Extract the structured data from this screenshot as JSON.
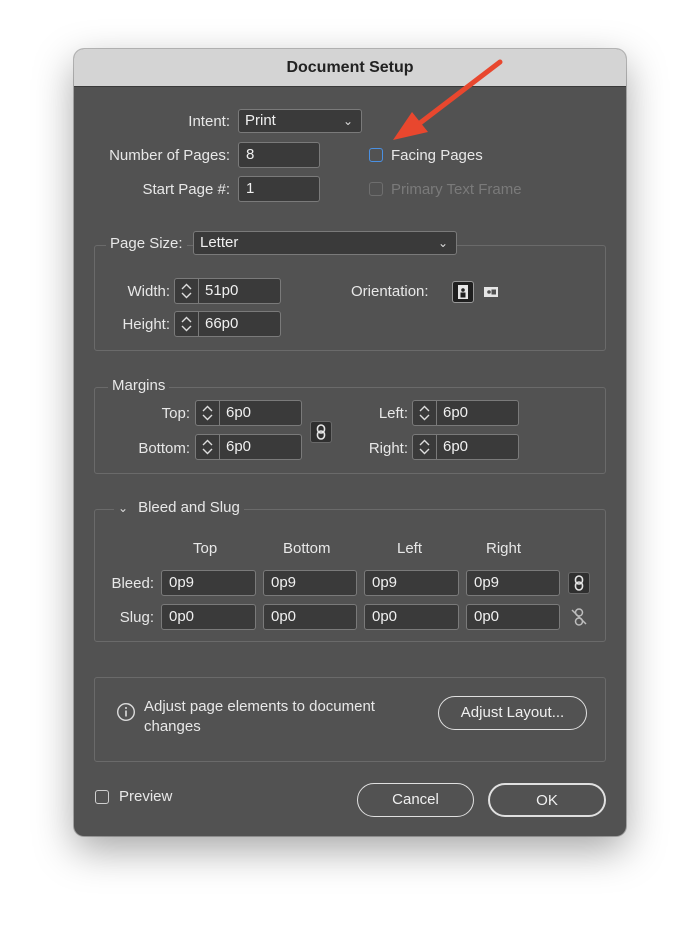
{
  "dialog": {
    "title": "Document Setup"
  },
  "general": {
    "intent_label": "Intent:",
    "intent_value": "Print",
    "num_pages_label": "Number of Pages:",
    "num_pages_value": "8",
    "start_page_label": "Start Page #:",
    "start_page_value": "1",
    "facing_pages_label": "Facing Pages",
    "facing_pages_checked": false,
    "primary_text_frame_label": "Primary Text Frame",
    "primary_text_frame_enabled": false
  },
  "page_size": {
    "label": "Page Size:",
    "value": "Letter",
    "width_label": "Width:",
    "width_value": "51p0",
    "height_label": "Height:",
    "height_value": "66p0",
    "orientation_label": "Orientation:",
    "orientation_selected": "portrait"
  },
  "margins": {
    "legend": "Margins",
    "top_label": "Top:",
    "top_value": "6p0",
    "bottom_label": "Bottom:",
    "bottom_value": "6p0",
    "left_label": "Left:",
    "left_value": "6p0",
    "right_label": "Right:",
    "right_value": "6p0",
    "linked": true
  },
  "bleed_slug": {
    "legend": "Bleed and Slug",
    "headers": [
      "Top",
      "Bottom",
      "Left",
      "Right"
    ],
    "bleed_label": "Bleed:",
    "bleed_values": [
      "0p9",
      "0p9",
      "0p9",
      "0p9"
    ],
    "slug_label": "Slug:",
    "slug_values": [
      "0p0",
      "0p0",
      "0p0",
      "0p0"
    ]
  },
  "adjust": {
    "message": "Adjust page elements to document changes",
    "message_line1": "Adjust page elements to document",
    "message_line2": "changes",
    "button_label": "Adjust Layout..."
  },
  "footer": {
    "preview_label": "Preview",
    "cancel_label": "Cancel",
    "ok_label": "OK"
  },
  "colors": {
    "dialog_bg": "#525252",
    "field_bg": "#3a3a3a",
    "checkbox_accent": "#4a90e2",
    "annotation_arrow": "#e8472e"
  }
}
